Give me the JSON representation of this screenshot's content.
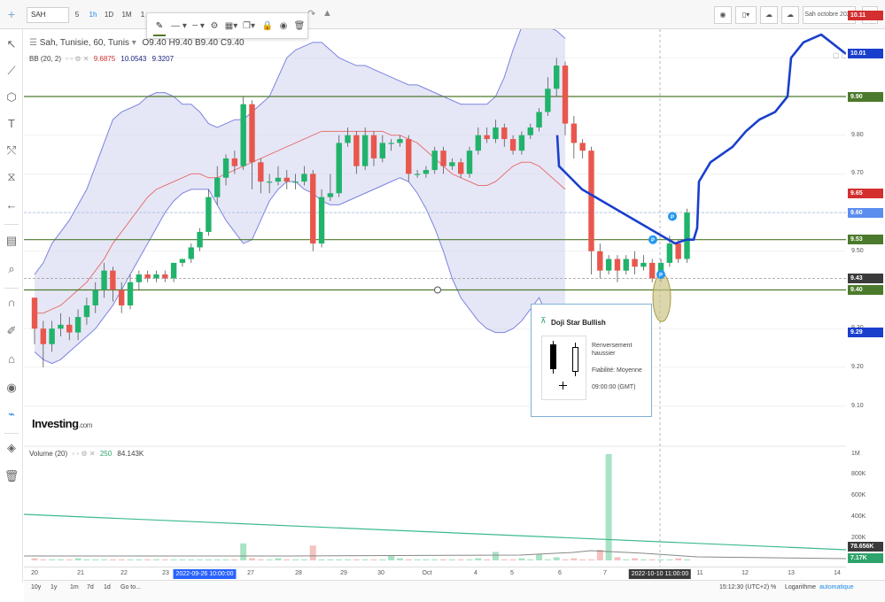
{
  "toolbar": {
    "symbol": "SAH",
    "timeframes": [
      "5",
      "1h",
      "1D",
      "1M",
      "1"
    ],
    "active_timeframe": "1h",
    "scenario_select": "Sah octobre 2022"
  },
  "legend": {
    "title": "Sah, Tunisie, 60, Tunis",
    "ohlc": "O9.40  H9.40  B9.40  C9.40"
  },
  "bb": {
    "label": "BB (20, 2)",
    "v1": "9.6875",
    "v2": "10.0543",
    "v3": "9.3207",
    "c1": "#d32f2f",
    "c2": "#1a237e",
    "c3": "#1a237e"
  },
  "volume": {
    "label": "Volume (20)",
    "v1": "250",
    "v2": "84.143K"
  },
  "price_axis": {
    "labels": [
      "10.00",
      "9.90",
      "9.80",
      "9.70",
      "9.60",
      "9.50",
      "9.40",
      "9.30",
      "9.20",
      "9.10"
    ],
    "vol_labels": [
      "1M",
      "800K",
      "600K",
      "400K",
      "200K"
    ],
    "tags": [
      {
        "text": "10.11",
        "color": "#d32f2f"
      },
      {
        "text": "10.01",
        "color": "#1a3fcc"
      },
      {
        "text": "9.90",
        "color": "#4c7a2c"
      },
      {
        "text": "9.65",
        "color": "#d32f2f"
      },
      {
        "text": "9.60",
        "color": "#5b8def"
      },
      {
        "text": "9.53",
        "color": "#4c7a2c"
      },
      {
        "text": "9.43",
        "color": "#3a3a3a"
      },
      {
        "text": "9.40",
        "color": "#4c7a2c"
      },
      {
        "text": "9.29",
        "color": "#1a3fcc"
      },
      {
        "text": "78.656K",
        "color": "#3a3a3a"
      },
      {
        "text": "7.17K",
        "color": "#2ea36b"
      }
    ]
  },
  "date_axis": {
    "labels": [
      "20",
      "21",
      "22",
      "23",
      "27",
      "28",
      "29",
      "30",
      "Oct",
      "4",
      "5",
      "6",
      "7",
      "11",
      "12",
      "13",
      "14"
    ],
    "crosshair_left": "2022-09-26 10:00:00",
    "crosshair_right": "2022-10-10 11:00:00"
  },
  "bottombar": {
    "ranges": [
      "10y",
      "1y",
      "1m",
      "7d",
      "1d",
      "Go to..."
    ],
    "time": "15:12:30 (UTC+2)",
    "pct": "%",
    "log": "Logarithme",
    "auto": "automatique"
  },
  "popup": {
    "title": "Doji Star Bullish",
    "line1": "Renversement",
    "line2": "haussier",
    "reliability": "Fiabilité: Moyenne",
    "time": "09:00:00 (GMT)"
  },
  "watermark": {
    "brand": "Investing",
    "suffix": ".com"
  },
  "chart_data": {
    "type": "candlestick",
    "symbol": "Sah, Tunisie, 60, Tunis",
    "candles": [
      [
        9.38,
        9.3,
        9.38,
        9.26
      ],
      [
        9.3,
        9.26,
        9.32,
        9.2
      ],
      [
        9.26,
        9.3,
        9.32,
        9.24
      ],
      [
        9.3,
        9.31,
        9.34,
        9.28
      ],
      [
        9.31,
        9.29,
        9.33,
        9.27
      ],
      [
        9.29,
        9.33,
        9.35,
        9.27
      ],
      [
        9.33,
        9.36,
        9.38,
        9.31
      ],
      [
        9.36,
        9.4,
        9.42,
        9.34
      ],
      [
        9.4,
        9.45,
        9.47,
        9.38
      ],
      [
        9.45,
        9.4,
        9.46,
        9.37
      ],
      [
        9.4,
        9.36,
        9.42,
        9.34
      ],
      [
        9.36,
        9.42,
        9.44,
        9.35
      ],
      [
        9.42,
        9.44,
        9.45,
        9.4
      ],
      [
        9.44,
        9.43,
        9.45,
        9.42
      ],
      [
        9.43,
        9.44,
        9.45,
        9.42
      ],
      [
        9.44,
        9.43,
        9.45,
        9.42
      ],
      [
        9.43,
        9.47,
        9.47,
        9.42
      ],
      [
        9.47,
        9.48,
        9.48,
        9.46
      ],
      [
        9.48,
        9.51,
        9.52,
        9.47
      ],
      [
        9.51,
        9.55,
        9.56,
        9.5
      ],
      [
        9.55,
        9.64,
        9.66,
        9.54
      ],
      [
        9.64,
        9.69,
        9.72,
        9.62
      ],
      [
        9.69,
        9.74,
        9.75,
        9.67
      ],
      [
        9.74,
        9.72,
        9.76,
        9.7
      ],
      [
        9.72,
        9.88,
        9.9,
        9.71
      ],
      [
        9.88,
        9.73,
        9.89,
        9.66
      ],
      [
        9.73,
        9.68,
        9.74,
        9.65
      ],
      [
        9.68,
        9.68,
        9.7,
        9.65
      ],
      [
        9.68,
        9.69,
        9.72,
        9.67
      ],
      [
        9.69,
        9.68,
        9.71,
        9.66
      ],
      [
        9.68,
        9.68,
        9.7,
        9.66
      ],
      [
        9.68,
        9.7,
        9.72,
        9.67
      ],
      [
        9.7,
        9.52,
        9.71,
        9.5
      ],
      [
        9.52,
        9.64,
        9.66,
        9.51
      ],
      [
        9.64,
        9.65,
        9.7,
        9.63
      ],
      [
        9.65,
        9.78,
        9.8,
        9.64
      ],
      [
        9.78,
        9.8,
        9.82,
        9.77
      ],
      [
        9.8,
        9.72,
        9.81,
        9.7
      ],
      [
        9.72,
        9.8,
        9.82,
        9.71
      ],
      [
        9.8,
        9.74,
        9.81,
        9.72
      ],
      [
        9.74,
        9.78,
        9.8,
        9.73
      ],
      [
        9.78,
        9.78,
        9.79,
        9.76
      ],
      [
        9.78,
        9.79,
        9.8,
        9.77
      ],
      [
        9.79,
        9.7,
        9.8,
        9.68
      ],
      [
        9.7,
        9.7,
        9.71,
        9.69
      ],
      [
        9.7,
        9.71,
        9.72,
        9.69
      ],
      [
        9.71,
        9.76,
        9.77,
        9.7
      ],
      [
        9.76,
        9.72,
        9.77,
        9.7
      ],
      [
        9.72,
        9.73,
        9.74,
        9.71
      ],
      [
        9.73,
        9.7,
        9.74,
        9.69
      ],
      [
        9.7,
        9.76,
        9.77,
        9.69
      ],
      [
        9.76,
        9.8,
        9.82,
        9.75
      ],
      [
        9.8,
        9.79,
        9.82,
        9.78
      ],
      [
        9.79,
        9.82,
        9.84,
        9.78
      ],
      [
        9.82,
        9.79,
        9.83,
        9.77
      ],
      [
        9.79,
        9.76,
        9.8,
        9.75
      ],
      [
        9.76,
        9.8,
        9.81,
        9.75
      ],
      [
        9.8,
        9.82,
        9.83,
        9.79
      ],
      [
        9.82,
        9.86,
        9.87,
        9.81
      ],
      [
        9.86,
        9.92,
        9.95,
        9.85
      ],
      [
        9.92,
        9.98,
        10.0,
        9.9
      ],
      [
        9.98,
        9.83,
        9.99,
        9.8
      ],
      [
        9.83,
        9.78,
        9.85,
        9.74
      ],
      [
        9.78,
        9.76,
        9.79,
        9.74
      ],
      [
        9.76,
        9.5,
        9.77,
        9.44
      ],
      [
        9.5,
        9.45,
        9.52,
        9.43
      ],
      [
        9.45,
        9.48,
        9.49,
        9.44
      ],
      [
        9.48,
        9.45,
        9.49,
        9.42
      ],
      [
        9.45,
        9.48,
        9.49,
        9.44
      ],
      [
        9.48,
        9.46,
        9.5,
        9.44
      ],
      [
        9.46,
        9.47,
        9.49,
        9.45
      ],
      [
        9.47,
        9.43,
        9.48,
        9.42
      ],
      [
        9.43,
        9.47,
        9.48,
        9.42
      ],
      [
        9.47,
        9.52,
        9.54,
        9.46
      ],
      [
        9.52,
        9.48,
        9.53,
        9.47
      ],
      [
        9.48,
        9.6,
        9.61,
        9.47
      ]
    ],
    "bb_upper": [
      9.44,
      9.47,
      9.52,
      9.55,
      9.58,
      9.62,
      9.66,
      9.72,
      9.78,
      9.84,
      9.86,
      9.87,
      9.88,
      9.9,
      9.91,
      9.91,
      9.9,
      9.88,
      9.88,
      9.86,
      9.83,
      9.82,
      9.83,
      9.84,
      9.84,
      9.86,
      9.88,
      9.9,
      9.95,
      10.0,
      10.02,
      10.03,
      10.04,
      10.04,
      10.02,
      10.0,
      9.99,
      9.98,
      9.98,
      9.97,
      9.96,
      9.95,
      9.94,
      9.93,
      9.93,
      9.92,
      9.91,
      9.9,
      9.89,
      9.88,
      9.88,
      9.88,
      9.88,
      9.9,
      9.95,
      10.02,
      10.08,
      10.1,
      10.09,
      10.08,
      10.07,
      10.05
    ],
    "bb_lower": [
      9.24,
      9.22,
      9.21,
      9.22,
      9.24,
      9.26,
      9.28,
      9.3,
      9.33,
      9.36,
      9.4,
      9.44,
      9.48,
      9.52,
      9.56,
      9.6,
      9.63,
      9.65,
      9.66,
      9.66,
      9.66,
      9.62,
      9.58,
      9.55,
      9.52,
      9.53,
      9.58,
      9.63,
      9.66,
      9.68,
      9.68,
      9.66,
      9.65,
      9.63,
      9.62,
      9.62,
      9.63,
      9.64,
      9.65,
      9.66,
      9.67,
      9.68,
      9.69,
      9.68,
      9.65,
      9.61,
      9.56,
      9.5,
      9.43,
      9.38,
      9.35,
      9.32,
      9.3,
      9.29,
      9.29,
      9.3,
      9.32,
      9.35,
      9.38,
      9.33,
      9.3,
      9.29
    ],
    "bb_mid": [
      9.34,
      9.34,
      9.35,
      9.36,
      9.38,
      9.4,
      9.42,
      9.45,
      9.48,
      9.52,
      9.55,
      9.58,
      9.61,
      9.64,
      9.66,
      9.67,
      9.68,
      9.69,
      9.7,
      9.7,
      9.69,
      9.69,
      9.7,
      9.71,
      9.72,
      9.73,
      9.74,
      9.75,
      9.76,
      9.77,
      9.78,
      9.79,
      9.8,
      9.81,
      9.81,
      9.81,
      9.81,
      9.81,
      9.81,
      9.81,
      9.81,
      9.8,
      9.8,
      9.79,
      9.78,
      9.76,
      9.74,
      9.72,
      9.7,
      9.69,
      9.68,
      9.67,
      9.67,
      9.68,
      9.7,
      9.72,
      9.73,
      9.73,
      9.72,
      9.7,
      9.68,
      9.66
    ],
    "volume": [
      2,
      1,
      1,
      1,
      1,
      2,
      1,
      1,
      1,
      1,
      1,
      1,
      1,
      1,
      1,
      1,
      1,
      1,
      1,
      1,
      1,
      1,
      1,
      1,
      16,
      2,
      1,
      1,
      2,
      1,
      1,
      1,
      14,
      1,
      1,
      1,
      1,
      1,
      1,
      1,
      1,
      5,
      2,
      1,
      1,
      1,
      1,
      1,
      1,
      1,
      1,
      2,
      1,
      8,
      1,
      1,
      2,
      1,
      6,
      1,
      3,
      1,
      2,
      1,
      1,
      10,
      100,
      3,
      1,
      2,
      1,
      1,
      1,
      1,
      2,
      1
    ],
    "horizontal_levels": [
      10.11,
      9.9,
      9.6,
      9.53,
      9.43,
      9.4
    ],
    "x_labels": [
      "20",
      "21",
      "22",
      "23",
      "27",
      "28",
      "29",
      "30",
      "Oct",
      "4",
      "5",
      "6",
      "7",
      "11",
      "12",
      "13",
      "14"
    ]
  }
}
